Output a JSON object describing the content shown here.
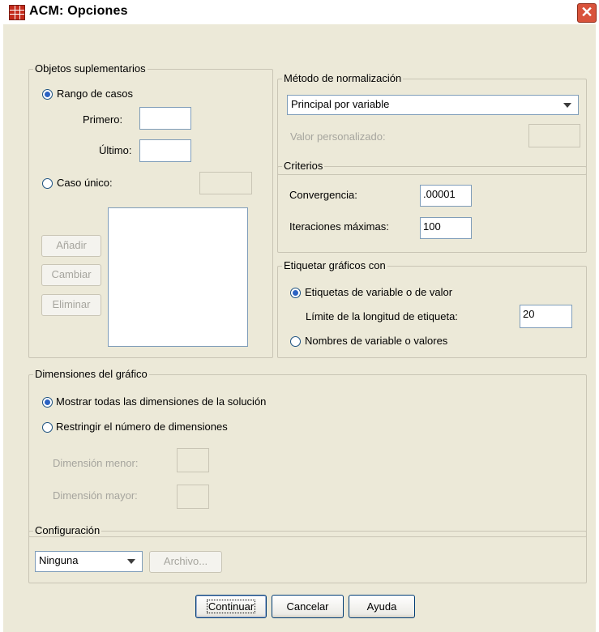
{
  "window": {
    "title": "ACM: Opciones",
    "close": "✕"
  },
  "supplementary": {
    "legend": "Objetos suplementarios",
    "range_label": "Rango de casos",
    "first_label": "Primero:",
    "first_value": "",
    "last_label": "Último:",
    "last_value": "",
    "single_label": "Caso único:",
    "single_value": "",
    "add_label": "Añadir",
    "change_label": "Cambiar",
    "remove_label": "Eliminar"
  },
  "normalization": {
    "legend": "Método de normalización",
    "selected": "Principal por variable",
    "custom_label": "Valor personalizado:",
    "custom_value": ""
  },
  "criteria": {
    "legend": "Criterios",
    "convergence_label": "Convergencia:",
    "convergence_value": ".00001",
    "iterations_label": "Iteraciones máximas:",
    "iterations_value": "100"
  },
  "labels": {
    "legend": "Etiquetar gráficos con",
    "option1": "Etiquetas de variable o de valor",
    "limit_label": "Límite de la longitud de etiqueta:",
    "limit_value": "20",
    "option2": "Nombres de variable o valores"
  },
  "dimensions": {
    "legend": "Dimensiones del gráfico",
    "option1": "Mostrar todas las dimensiones de la solución",
    "option2": "Restringir el número de dimensiones",
    "lower_label": "Dimensión menor:",
    "lower_value": "",
    "upper_label": "Dimensión mayor:",
    "upper_value": ""
  },
  "configuration": {
    "legend": "Configuración",
    "selected": "Ninguna",
    "file_label": "Archivo..."
  },
  "buttons": {
    "continue": "Continuar",
    "cancel": "Cancelar",
    "help": "Ayuda"
  }
}
